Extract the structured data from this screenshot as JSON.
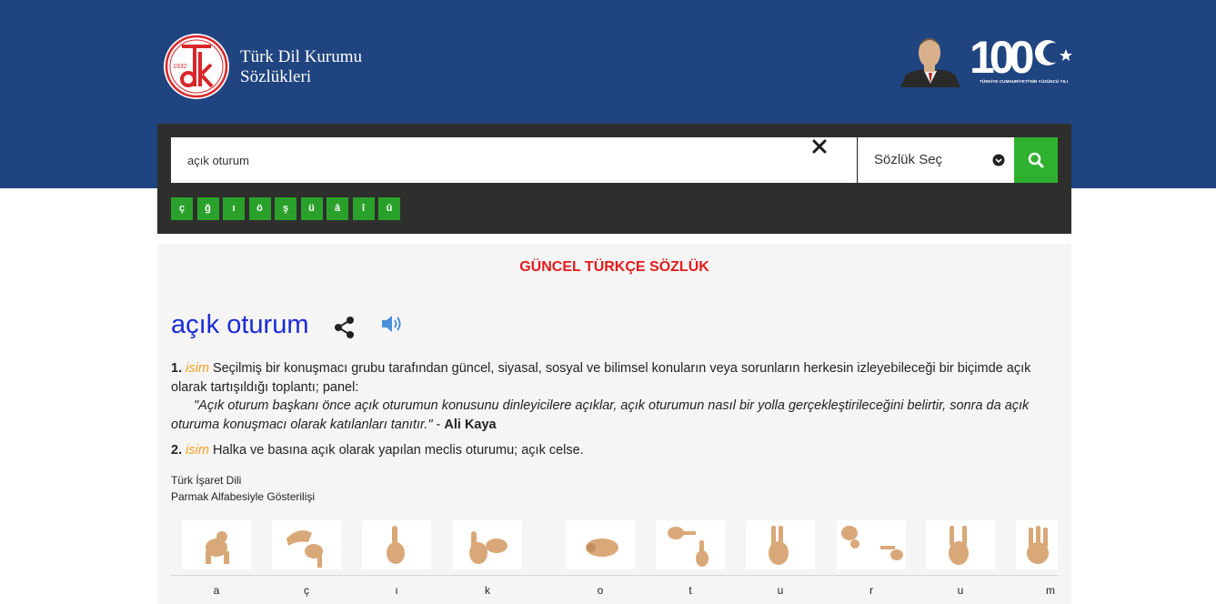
{
  "brand": {
    "logo_year": "1932",
    "logo_letters": "tdk",
    "line1": "Türk Dil Kurumu",
    "line2": "Sözlükleri",
    "centennial_caption": "TÜRKİYE CUMHURİYETİ'NİN YÜZÜNCÜ YILI",
    "centennial_number": "100"
  },
  "search": {
    "value": "açık oturum",
    "select_label": "Sözlük Seç",
    "special_chars": [
      "ç",
      "ğ",
      "ı",
      "ö",
      "ş",
      "ü",
      "â",
      "î",
      "û"
    ]
  },
  "dictionary": {
    "title": "GÜNCEL TÜRKÇE SÖZLÜK",
    "headword": "açık oturum",
    "meanings": [
      {
        "num": "1.",
        "pos": "isim",
        "text": "Seçilmiş bir konuşmacı grubu tarafından güncel, siyasal, sosyal ve bilimsel konuların veya sorunların herkesin izleyebileceği bir biçimde açık olarak tartışıldığı toplantı; panel:",
        "example": "\"Açık oturum başkanı önce açık oturumun konusunu dinleyicilere açıklar, açık oturumun nasıl bir yolla gerçekleştirileceğini belirtir, sonra da açık oturuma konuşmacı olarak katılanları tanıtır.\"",
        "example_sep": " - ",
        "author": "Ali Kaya"
      },
      {
        "num": "2.",
        "pos": "isim",
        "text": "Halka ve basına açık olarak yapılan meclis oturumu; açık celse."
      }
    ],
    "sign_language_label": "Türk İşaret Dili",
    "finger_spelling_label": "Parmak Alfabesiyle Gösterilişi",
    "letters": [
      "a",
      "ç",
      "ı",
      "k",
      "o",
      "t",
      "u",
      "r",
      "u",
      "m"
    ]
  },
  "colors": {
    "header_blue": "#1f4480",
    "panel_dark": "#2e2f2c",
    "green": "#2fb02f",
    "title_red": "#e41b1b",
    "headword_blue": "#1a2bd6",
    "pos_orange": "#f5a020"
  },
  "icons": {
    "clear": "close-icon",
    "select": "chevron-down-icon",
    "search": "search-icon",
    "share": "share-icon",
    "sound": "speaker-icon"
  }
}
